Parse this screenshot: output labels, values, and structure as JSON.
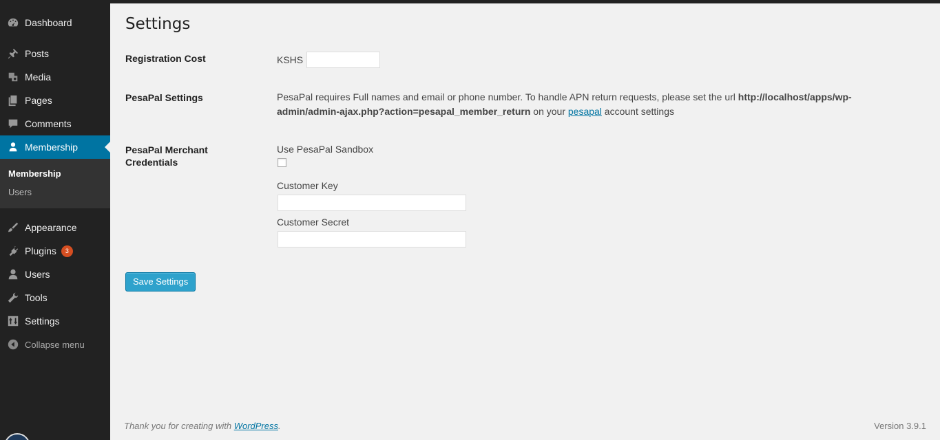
{
  "sidebar": {
    "items": [
      {
        "label": "Dashboard",
        "icon": "dashboard-icon"
      },
      {
        "label": "Posts",
        "icon": "pushpin-icon"
      },
      {
        "label": "Media",
        "icon": "media-icon"
      },
      {
        "label": "Pages",
        "icon": "pages-icon"
      },
      {
        "label": "Comments",
        "icon": "comment-icon"
      },
      {
        "label": "Membership",
        "icon": "user-icon",
        "active": true
      },
      {
        "label": "Appearance",
        "icon": "paintbrush-icon"
      },
      {
        "label": "Plugins",
        "icon": "plug-icon",
        "badge": "3"
      },
      {
        "label": "Users",
        "icon": "users-icon"
      },
      {
        "label": "Tools",
        "icon": "wrench-icon"
      },
      {
        "label": "Settings",
        "icon": "settings-icon"
      }
    ],
    "submenu": [
      "Membership",
      "Users"
    ],
    "collapse_label": "Collapse menu"
  },
  "page": {
    "title": "Settings",
    "registration_cost": {
      "label": "Registration Cost",
      "currency": "KSHS",
      "value": ""
    },
    "pesapal_settings": {
      "label": "PesaPal Settings",
      "text_before": "PesaPal requires Full names and email or phone number. To handle APN return requests, please set the url ",
      "url": "http://localhost/apps/wp-admin/admin-ajax.php?action=pesapal_member_return",
      "text_middle": " on your ",
      "link": "pesapal",
      "text_after": " account settings"
    },
    "credentials": {
      "label": "PesaPal Merchant Credentials",
      "sandbox_label": "Use PesaPal Sandbox",
      "sandbox_checked": false,
      "key_label": "Customer Key",
      "key_value": "",
      "secret_label": "Customer Secret",
      "secret_value": ""
    },
    "save_label": "Save Settings"
  },
  "footer": {
    "thanks_text": "Thank you for creating with ",
    "thanks_link": "WordPress",
    "thanks_end": ".",
    "version": "Version 3.9.1"
  },
  "colors": {
    "accent": "#0074a2",
    "button": "#2ea2cc",
    "badge": "#d54e21",
    "sidebar": "#222222"
  }
}
